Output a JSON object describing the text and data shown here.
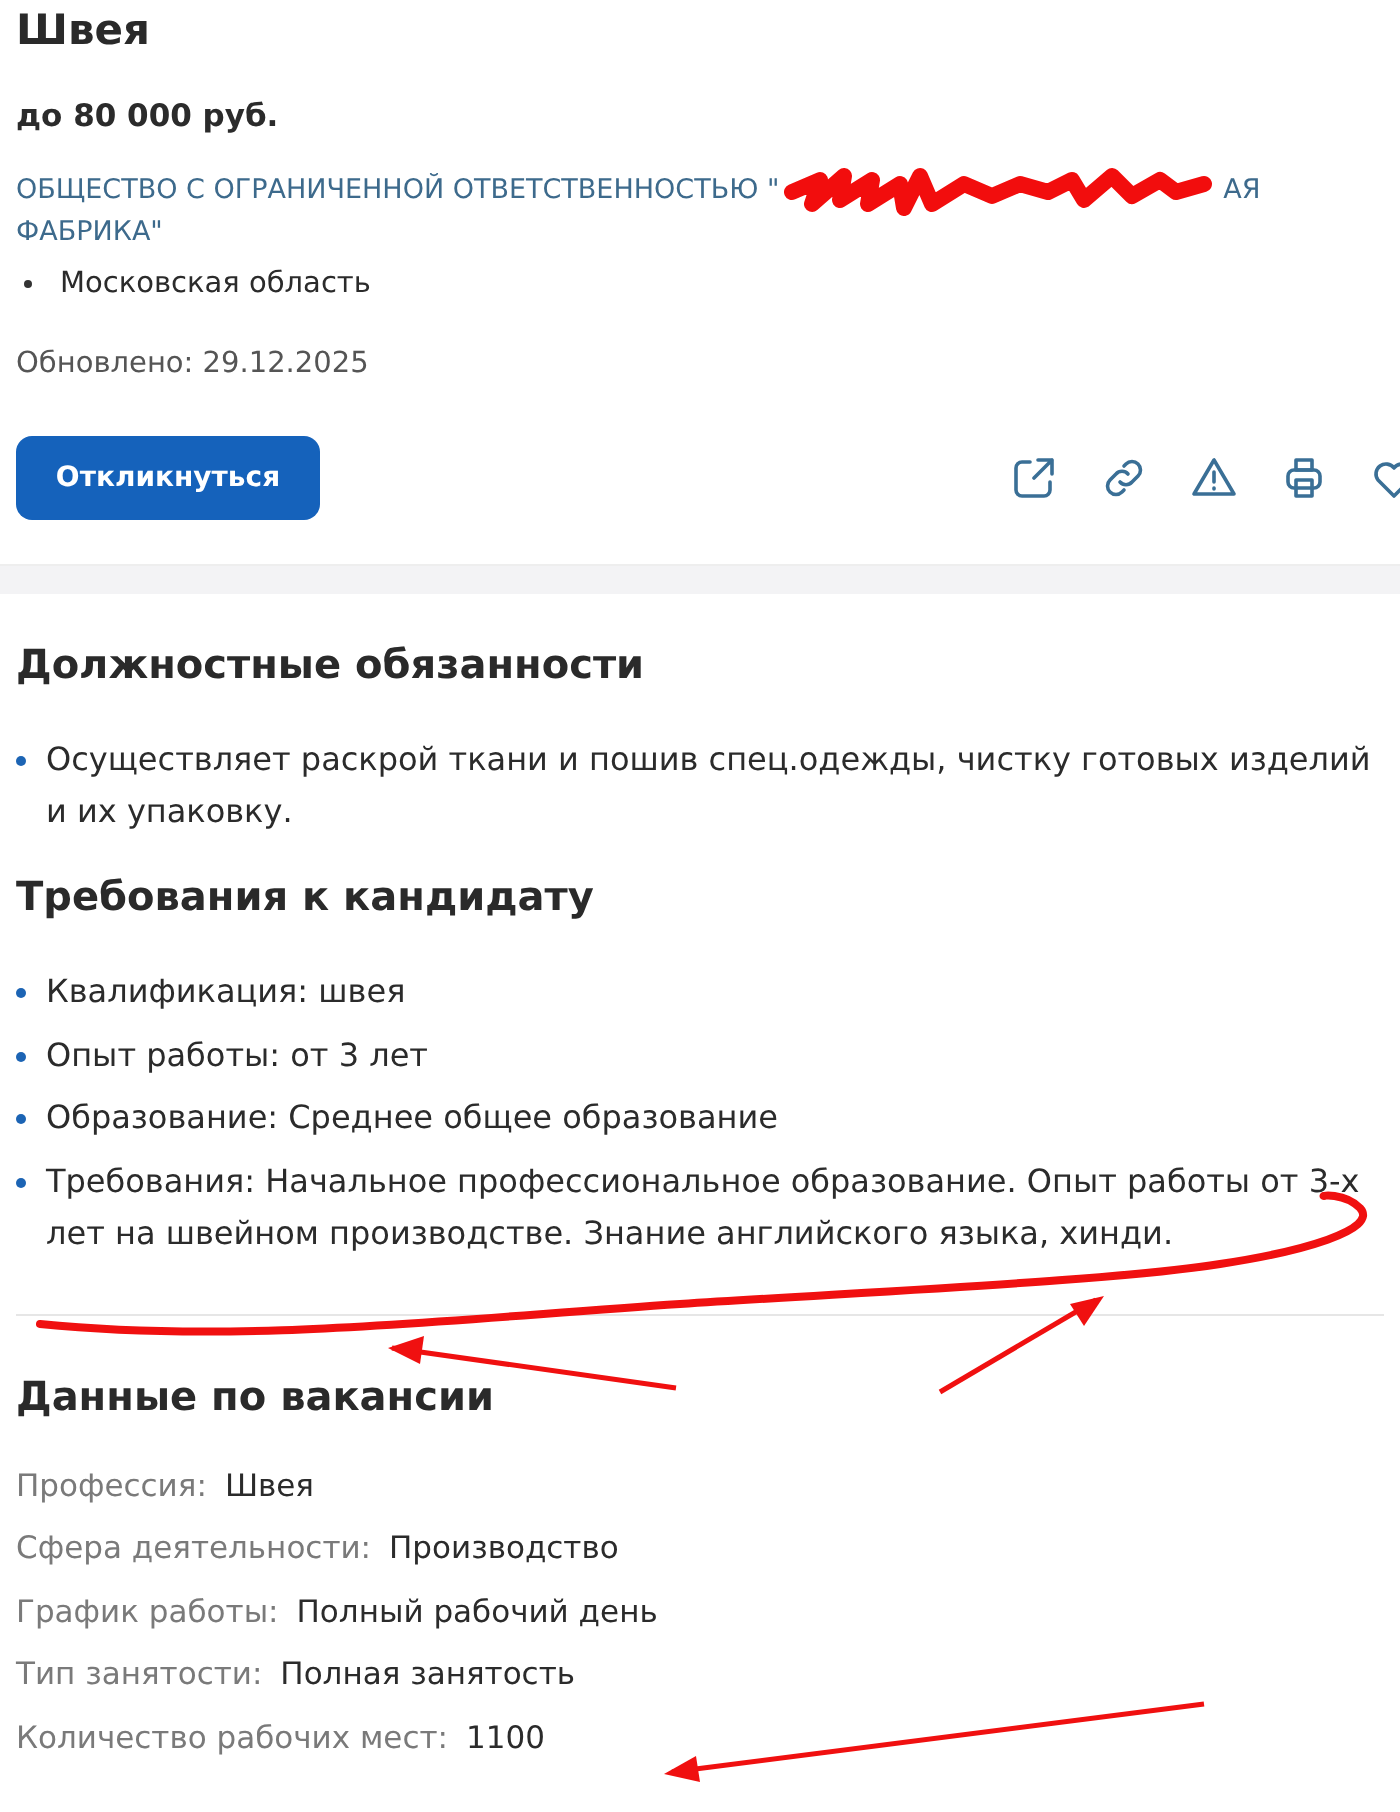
{
  "title": "Швея",
  "salary": "до 80 000 руб.",
  "company": {
    "parts": [
      "ОБЩЕСТВО С ОГРАНИЧЕННОЙ ОТВЕТСТВЕННОСТЬЮ \"",
      "АЯ",
      "ФАБРИКА\""
    ]
  },
  "location": "Московская область",
  "updated": "Обновлено: 29.12.2025",
  "apply_button": "Откликнуться",
  "actions": [
    {
      "kind": "share"
    },
    {
      "kind": "link"
    },
    {
      "kind": "report"
    },
    {
      "kind": "print"
    },
    {
      "kind": "favorite"
    }
  ],
  "sections": [
    {
      "heading": "Должностные обязанности",
      "items": [
        "Осуществляет раскрой ткани и пошив спец.одежды, чистку готовых изделий и их упаковку."
      ]
    },
    {
      "heading": "Требования к кандидату",
      "items": [
        "Квалификация: швея",
        "Опыт работы: от 3 лет",
        "Образование: Среднее общее образование",
        "Требования: Начальное профессиональное образование. Опыт работы от 3-х лет на швейном производстве. Знание английского языка, хинди."
      ]
    }
  ],
  "details": {
    "heading": "Данные по вакансии",
    "rows": [
      {
        "label": "Профессия:",
        "value": "Швея"
      },
      {
        "label": "Сфера деятельности:",
        "value": "Производство"
      },
      {
        "label": "График работы:",
        "value": "Полный рабочий день"
      },
      {
        "label": "Тип занятости:",
        "value": "Полная занятость"
      },
      {
        "label": "Количество рабочих мест:",
        "value": "1100"
      }
    ]
  }
}
